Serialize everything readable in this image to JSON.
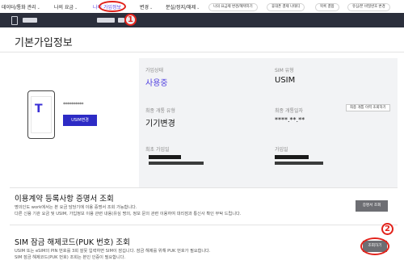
{
  "nav": {
    "items": [
      {
        "label": "데이터/통화 관리",
        "active": false
      },
      {
        "label": "나의 요금",
        "active": false
      },
      {
        "label": "나의 가입정보",
        "active": true
      },
      {
        "label": "변경",
        "active": false
      },
      {
        "label": "분실/정지/해제",
        "active": false
      }
    ],
    "pills": [
      "나의 요금제 변경/혜택하기",
      "휴대폰 결제 나태티",
      "목록 결합",
      "유심/폰 비밀번호 변경"
    ]
  },
  "annotations": {
    "marker_1": "1",
    "marker_2": "2"
  },
  "page": {
    "title": "기본가입정보"
  },
  "info": {
    "plan_label": "가입상태",
    "plan_value": "사용중",
    "sim_label": "SIM 유형",
    "sim_value": "USIM",
    "change_label": "최종 개통 유형",
    "change_value": "기기변경",
    "last_change_label": "최종 개통일자",
    "last_change_value": "****.**.**",
    "last_change_button": "최종 개통 이력 조회하기",
    "name_label": "최초 가입일",
    "date_label": "가입일",
    "usim_button": "USIM변경",
    "dots": "**********"
  },
  "cert": {
    "title": "이용계약 등록사항 증명서 조회",
    "desc_line1": "명의인도 work에서는 본 요금 담당기에 이용 증명서 조회 가능합니다.",
    "desc_line2": "다른 신용 기관 요금 및 USIM, 가입정보 이용 관련 내용(유심 명의, 정보 문의 관련 이용하여 대리점과 통신사 확인 부탁 드립니다.",
    "button": "증명서 조회"
  },
  "puk": {
    "title": "SIM 잠금 해제코드(PUK 번호) 조회",
    "desc_line1": "USIM 또는 eSIM의 PIN 번호를 3회 잘못 입력하면 SIM이 잠깁니다. 잠금 해제를 위해 PUK 번호가 필요합니다.",
    "desc_line2": "SIM 잠금 해제코드(PUK 번호) 조회는 본인 인증이 필요합니다.",
    "button": "조회하기"
  },
  "colors": {
    "accent": "#4f3ee0",
    "annotation": "#e2221b",
    "strip": "#2b2f3c",
    "button": "#6d6e73"
  }
}
